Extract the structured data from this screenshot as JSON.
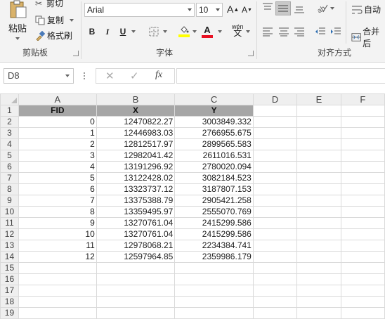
{
  "ribbon": {
    "clipboard": {
      "paste_label": "粘贴",
      "cut_label": "剪切",
      "copy_label": "复制",
      "format_painter_label": "格式刷",
      "group_label": "剪贴板"
    },
    "font": {
      "font_name": "Arial",
      "font_size": "10",
      "grow_icon": "A",
      "shrink_icon": "A",
      "bold_label": "B",
      "italic_label": "I",
      "underline_label": "U",
      "font_color_label": "A",
      "phonetic_label": "wén",
      "group_label": "字体",
      "highlight_color": "#ffff00",
      "font_color": "#e81123"
    },
    "alignment": {
      "wrap_label": "自动",
      "merge_label": "合并后",
      "group_label": "对齐方式"
    }
  },
  "formula_bar": {
    "name_box": "D8",
    "fx_label": "fx",
    "formula_value": ""
  },
  "sheet": {
    "columns": [
      "A",
      "B",
      "C",
      "D",
      "E",
      "F"
    ],
    "rows": [
      {
        "n": "1",
        "cells": [
          "FID",
          "X",
          "Y"
        ]
      },
      {
        "n": "2",
        "cells": [
          "0",
          "12470822.27",
          "3003849.332"
        ]
      },
      {
        "n": "3",
        "cells": [
          "1",
          "12446983.03",
          "2766955.675"
        ]
      },
      {
        "n": "4",
        "cells": [
          "2",
          "12812517.97",
          "2899565.583"
        ]
      },
      {
        "n": "5",
        "cells": [
          "3",
          "12982041.42",
          "2611016.531"
        ]
      },
      {
        "n": "6",
        "cells": [
          "4",
          "13191296.92",
          "2780020.094"
        ]
      },
      {
        "n": "7",
        "cells": [
          "5",
          "13122428.02",
          "3082184.523"
        ]
      },
      {
        "n": "8",
        "cells": [
          "6",
          "13323737.12",
          "3187807.153"
        ]
      },
      {
        "n": "9",
        "cells": [
          "7",
          "13375388.79",
          "2905421.258"
        ]
      },
      {
        "n": "10",
        "cells": [
          "8",
          "13359495.97",
          "2555070.769"
        ]
      },
      {
        "n": "11",
        "cells": [
          "9",
          "13270761.04",
          "2415299.586"
        ]
      },
      {
        "n": "12",
        "cells": [
          "10",
          "13270761.04",
          "2415299.586"
        ]
      },
      {
        "n": "13",
        "cells": [
          "11",
          "12978068.21",
          "2234384.741"
        ]
      },
      {
        "n": "14",
        "cells": [
          "12",
          "12597964.85",
          "2359986.179"
        ]
      },
      {
        "n": "15",
        "cells": [
          "",
          "",
          ""
        ]
      },
      {
        "n": "16",
        "cells": [
          "",
          "",
          ""
        ]
      },
      {
        "n": "17",
        "cells": [
          "",
          "",
          ""
        ]
      },
      {
        "n": "18",
        "cells": [
          "",
          "",
          ""
        ]
      },
      {
        "n": "19",
        "cells": [
          "",
          "",
          ""
        ]
      }
    ]
  },
  "colors": {
    "header_fill": "#a6a6a6",
    "ribbon_bg": "#f3f3f3",
    "gridline": "#dadada"
  }
}
